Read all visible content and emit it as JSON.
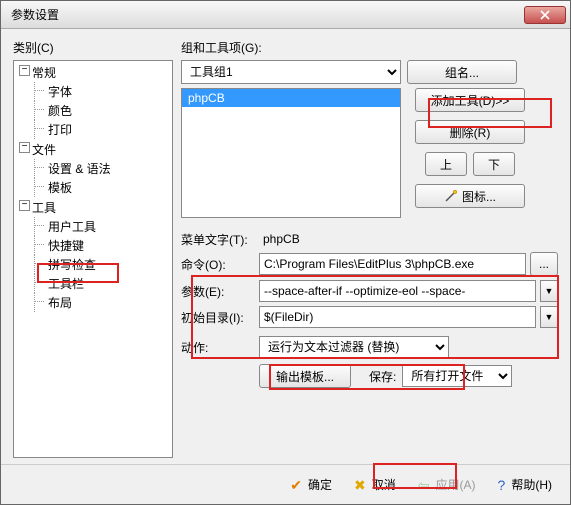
{
  "window": {
    "title": "参数设置"
  },
  "left": {
    "label": "类别(C)",
    "tree": [
      {
        "label": "常规",
        "children": [
          "字体",
          "颜色",
          "打印"
        ]
      },
      {
        "label": "文件",
        "children": [
          "设置 & 语法",
          "模板"
        ]
      },
      {
        "label": "工具",
        "children": [
          "用户工具",
          "快捷键",
          "拼写检查",
          "工具栏",
          "布局"
        ]
      }
    ]
  },
  "right": {
    "group_label": "组和工具项(G):",
    "group_combo": "工具组1",
    "group_name_btn": "组名...",
    "list_items": [
      "phpCB"
    ],
    "list_selected": 0,
    "add_tool_btn": "添加工具(D)>>",
    "delete_btn": "删除(R)",
    "up_btn": "上",
    "down_btn": "下",
    "icon_btn": "图标...",
    "menu_text_label": "菜单文字(T):",
    "menu_text_value": "phpCB",
    "command_label": "命令(O):",
    "command_value": "C:\\Program Files\\EditPlus 3\\phpCB.exe",
    "browse_btn": "...",
    "params_label": "参数(E):",
    "params_value": "--space-after-if --optimize-eol --space-",
    "initdir_label": "初始目录(I):",
    "initdir_value": "$(FileDir)",
    "action_label": "动作:",
    "action_value": "运行为文本过滤器 (替换)",
    "output_tmpl_btn": "输出模板...",
    "save_label": "保存:",
    "save_value": "所有打开文件"
  },
  "footer": {
    "ok": "确定",
    "cancel": "取消",
    "apply": "应用(A)",
    "help": "帮助(H)"
  }
}
